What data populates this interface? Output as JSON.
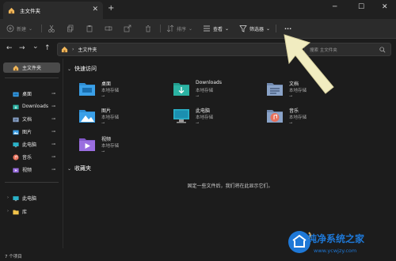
{
  "window": {
    "tab_title": "主文件夹",
    "new_tab": "+",
    "tab_close": "✕",
    "minimize": "─",
    "maximize": "☐",
    "close": "✕"
  },
  "toolbar": {
    "new_label": "新建",
    "sort_label": "排序",
    "view_label": "查看",
    "filter_label": "筛选器",
    "more_label": "···"
  },
  "nav": {
    "back": "←",
    "forward": "→",
    "down": "⌄",
    "up": "↑",
    "breadcrumb": [
      "主文件夹"
    ],
    "breadcrumb_sep": "›",
    "search_placeholder": "搜索 主文件夹"
  },
  "sidebar": {
    "items": [
      {
        "label": "主文件夹",
        "icon": "home-icon",
        "selected": true
      },
      {
        "label": "桌面",
        "icon": "desktop-folder-icon",
        "pinned": true
      },
      {
        "label": "Downloads",
        "icon": "downloads-folder-icon",
        "pinned": true
      },
      {
        "label": "文档",
        "icon": "documents-folder-icon",
        "pinned": true
      },
      {
        "label": "图片",
        "icon": "pictures-folder-icon",
        "pinned": true
      },
      {
        "label": "此电脑",
        "icon": "this-pc-icon",
        "pinned": true
      },
      {
        "label": "音乐",
        "icon": "music-folder-icon",
        "pinned": true
      },
      {
        "label": "视频",
        "icon": "videos-folder-icon",
        "pinned": true
      },
      {
        "label": "此电脑",
        "icon": "this-pc-icon",
        "expandable": true
      },
      {
        "label": "库",
        "icon": "library-folder-icon",
        "expandable": true
      }
    ],
    "pin_glyph": "📌"
  },
  "main": {
    "quick_access_title": "快速访问",
    "favorites_title": "收藏夹",
    "favorites_empty": "固定一些文件后，我们将在此显示它们。",
    "quick_access_items": [
      {
        "name": "桌面",
        "sub": "本地存储",
        "icon": "desktop-folder-icon"
      },
      {
        "name": "Downloads",
        "sub": "本地存储",
        "icon": "downloads-folder-icon"
      },
      {
        "name": "文档",
        "sub": "本地存储",
        "icon": "documents-folder-icon"
      },
      {
        "name": "图片",
        "sub": "本地存储",
        "icon": "pictures-folder-icon"
      },
      {
        "name": "此电脑",
        "sub": "本地存储",
        "icon": "this-pc-icon"
      },
      {
        "name": "音乐",
        "sub": "本地存储",
        "icon": "music-folder-icon"
      },
      {
        "name": "视频",
        "sub": "本地存储",
        "icon": "videos-folder-icon"
      }
    ]
  },
  "status": {
    "count": "7 个项目"
  },
  "watermark": {
    "title": "纯净系统之家",
    "url": "www.ycwjzy.com"
  },
  "colors": {
    "background": "#1c1c1c",
    "toolbar": "#2b2b2b",
    "selected": "#4a4a4a",
    "folder_blue": "#3ba0e8",
    "folder_teal": "#2bb3a3",
    "arrow_annotation": "#f1ecc0",
    "watermark_blue": "#1e78d7"
  }
}
